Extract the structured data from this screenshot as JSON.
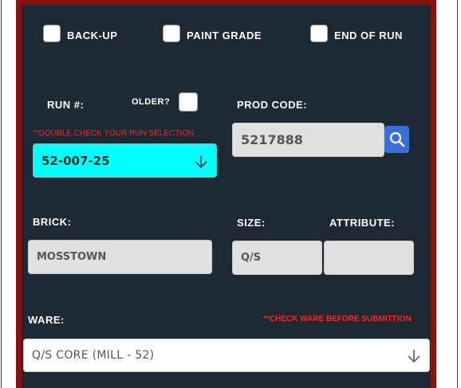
{
  "options": {
    "backup_label": "BACK-UP",
    "paint_grade_label": "PAINT GRADE",
    "end_of_run_label": "END OF RUN"
  },
  "run": {
    "label": "RUN #:",
    "older_label": "OLDER?",
    "warning": "**DOUBLE CHECK YOUR RUN SELECTION",
    "selected": "52-007-25"
  },
  "prod_code": {
    "label": "PROD CODE:",
    "value": "5217888"
  },
  "brick": {
    "label": "BRICK:",
    "value": "MOSSTOWN"
  },
  "size": {
    "label": "SIZE:",
    "value": "Q/S"
  },
  "attribute": {
    "label": "ATTRIBUTE:",
    "value": ""
  },
  "ware": {
    "label": "WARE:",
    "warning": "**CHECK WARE BEFORE SUBMITTION",
    "selected": "Q/S CORE (MILL - 52)"
  },
  "icons": [
    "search-icon",
    "arrow-down-icon"
  ],
  "colors": {
    "panel": "#1e2a33",
    "frame": "#8b1010",
    "run_select": "#00ffff",
    "search_button": "#3b6fd8",
    "warning": "#ff2020"
  }
}
